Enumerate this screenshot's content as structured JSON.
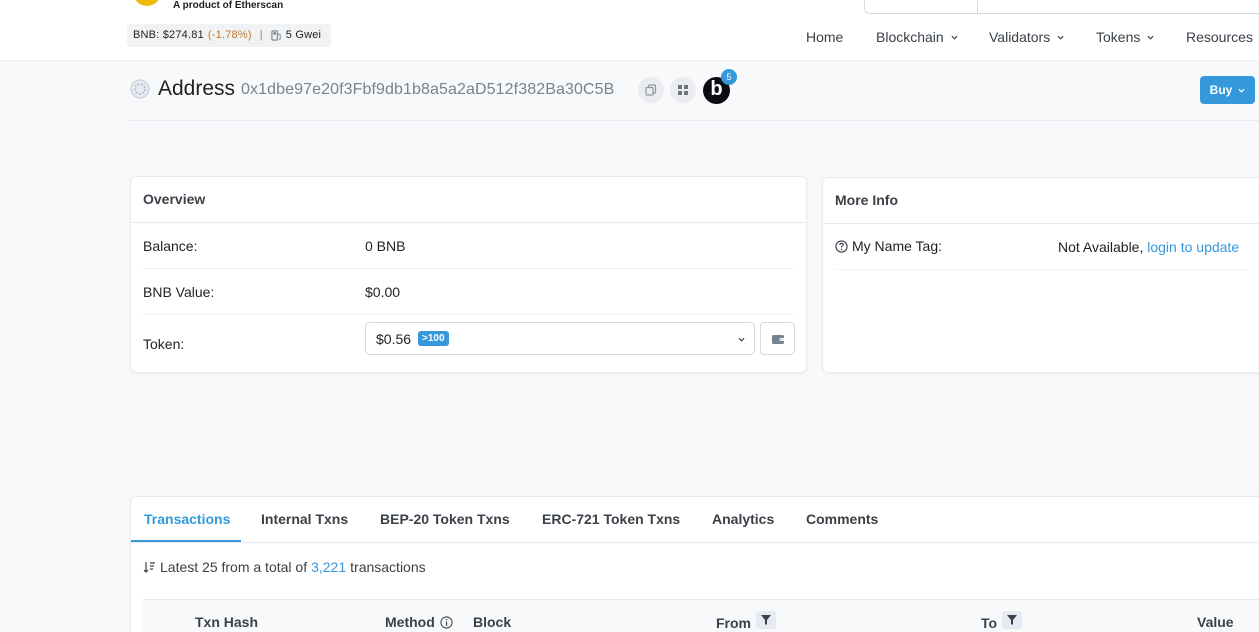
{
  "header": {
    "logo_sub": "A product of Etherscan",
    "price": {
      "label": "BNB: $274.81",
      "change": "(-1.78%)",
      "separator": "|",
      "gas": "5 Gwei"
    },
    "nav": [
      {
        "label": "Home",
        "has_dropdown": false
      },
      {
        "label": "Blockchain",
        "has_dropdown": true
      },
      {
        "label": "Validators",
        "has_dropdown": true
      },
      {
        "label": "Tokens",
        "has_dropdown": true
      },
      {
        "label": "Resources",
        "has_dropdown": false
      }
    ]
  },
  "title": {
    "label": "Address",
    "address": "0x1dbe97e20f3Fbf9db1b8a5a2aD512f382Ba30C5B",
    "badge_count": "5",
    "b_logo": "b",
    "buy_label": "Buy"
  },
  "overview": {
    "heading": "Overview",
    "balance_label": "Balance:",
    "balance_value": "0 BNB",
    "value_label": "BNB Value:",
    "value_value": "$0.00",
    "token_label": "Token:",
    "token_value": "$0.56",
    "token_badge": ">100"
  },
  "more_info": {
    "heading": "More Info",
    "name_tag_label": "My Name Tag:",
    "name_tag_value": "Not Available,",
    "name_tag_link": "login to update"
  },
  "tabs": {
    "items": [
      "Transactions",
      "Internal Txns",
      "BEP-20 Token Txns",
      "ERC-721 Token Txns",
      "Analytics",
      "Comments"
    ],
    "active": "Transactions"
  },
  "summary": {
    "prefix": "Latest 25 from a total of",
    "count": "3,221",
    "suffix": "transactions"
  },
  "table": {
    "columns": [
      "Txn Hash",
      "Method",
      "Block",
      "From",
      "To",
      "Value"
    ]
  },
  "colors": {
    "accent": "#3498db",
    "price_change": "#c17a2b"
  },
  "icons": [
    "copy-icon",
    "qr-code-icon",
    "chevron-down-icon",
    "wallet-icon",
    "question-circle-icon",
    "sort-icon",
    "filter-icon",
    "info-icon",
    "gas-pump-icon",
    "address-icon"
  ]
}
